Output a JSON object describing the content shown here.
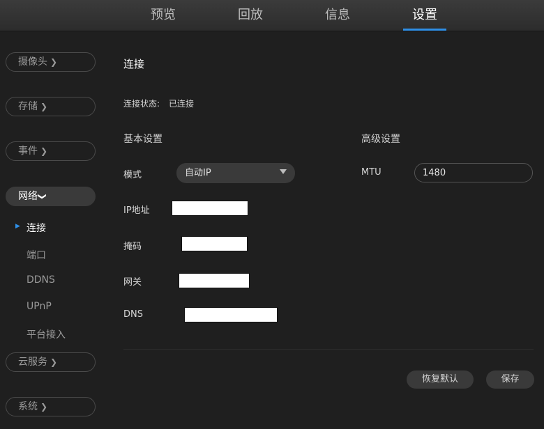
{
  "nav": {
    "tabs": [
      {
        "label": "预览"
      },
      {
        "label": "回放"
      },
      {
        "label": "信息"
      },
      {
        "label": "设置"
      }
    ],
    "active_tab": "设置",
    "accent_color": "#2f8fe6"
  },
  "sidebar": {
    "camera": "摄像头",
    "storage": "存储",
    "events": "事件",
    "network": "网络",
    "network_sub": {
      "connect": "连接",
      "port": "端口",
      "ddns": "DDNS",
      "upnp": "UPnP",
      "platform": "平台接入"
    },
    "cloud": "云服务",
    "system": "系统"
  },
  "main": {
    "title": "连接",
    "status_label": "连接状态:",
    "status_value": "已连接",
    "basic_header": "基本设置",
    "advanced_header": "高级设置",
    "mode_label": "模式",
    "mode_value": "自动IP",
    "ip_label": "IP地址",
    "mask_label": "掩码",
    "gateway_label": "网关",
    "dns_label": "DNS",
    "mtu_label": "MTU",
    "mtu_value": "1480",
    "restore_button": "恢复默认",
    "save_button": "保存"
  }
}
